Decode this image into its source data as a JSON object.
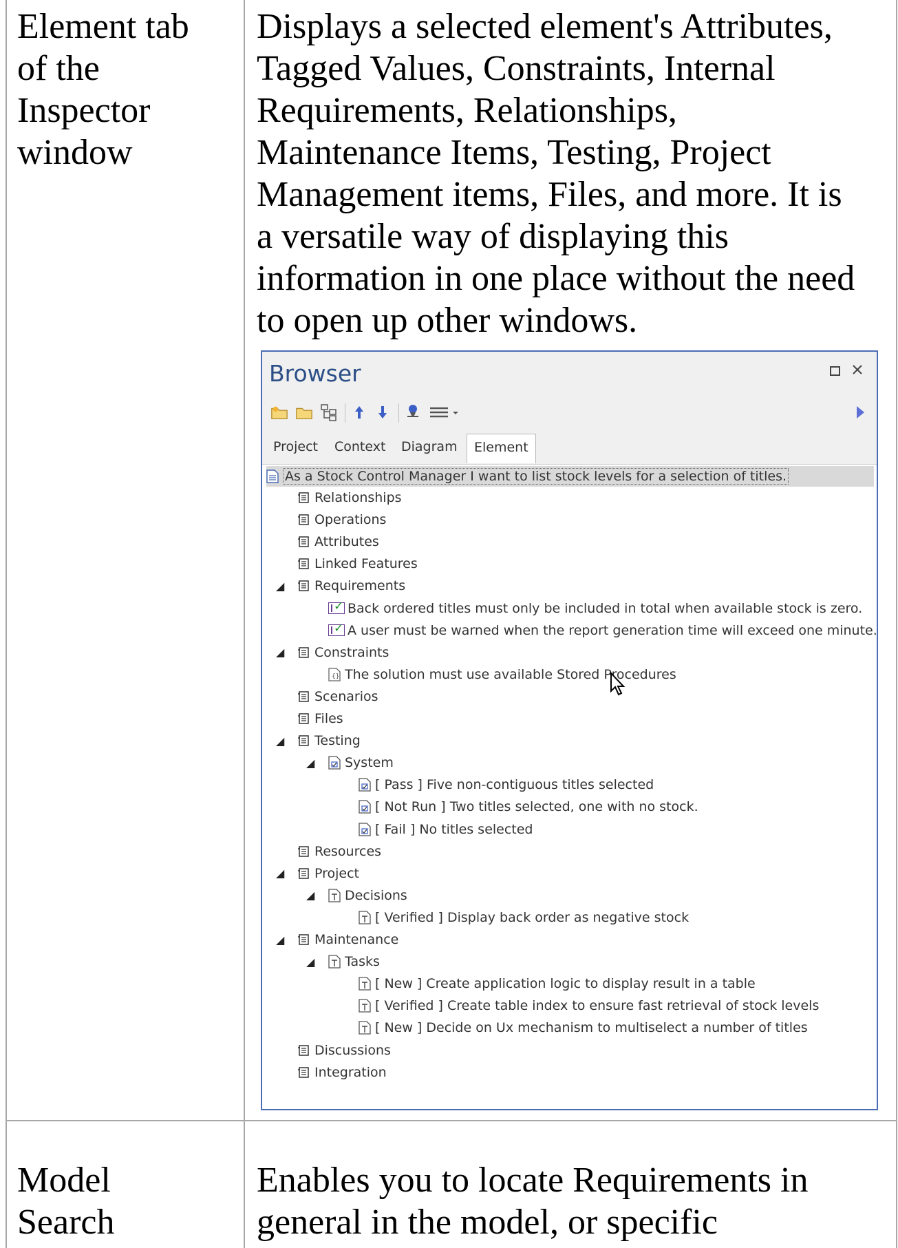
{
  "row1": {
    "term": [
      "Element tab",
      "of the",
      "Inspector",
      "window"
    ],
    "description": [
      "Displays a selected element's Attributes,",
      "Tagged Values, Constraints, Internal",
      "Requirements, Relationships,",
      "Maintenance Items, Testing, Project",
      "Management items, Files, and more. It is",
      "a versatile way of displaying this",
      "information in one place without the need",
      "to open up other windows."
    ]
  },
  "browser": {
    "title": "Browser",
    "maximize_icon": "maximize-icon",
    "close_icon": "close-icon",
    "tabs": [
      "Project",
      "Context",
      "Diagram",
      "Element"
    ],
    "active_tab": "Element",
    "selected_item": "As a Stock Control Manager I want to list stock levels for a selection of titles.",
    "tree": [
      {
        "label": "Relationships",
        "icon": "compartment-icon",
        "level": 1,
        "expanded": false
      },
      {
        "label": "Operations",
        "icon": "compartment-icon",
        "level": 1,
        "expanded": false
      },
      {
        "label": "Attributes",
        "icon": "compartment-icon",
        "level": 1,
        "expanded": false
      },
      {
        "label": "Linked Features",
        "icon": "compartment-icon",
        "level": 1,
        "expanded": false
      },
      {
        "label": "Requirements",
        "icon": "compartment-icon",
        "level": 1,
        "expanded": true
      },
      {
        "label": "Back ordered titles must only be included in total when available stock is zero.",
        "icon": "requirement-check-icon",
        "level": 2
      },
      {
        "label": "A user must be warned when the report generation time will exceed one minute.",
        "icon": "requirement-check-icon",
        "level": 2
      },
      {
        "label": "Constraints",
        "icon": "compartment-icon",
        "level": 1,
        "expanded": true
      },
      {
        "label": "The solution must use available Stored Procedures",
        "icon": "constraint-icon",
        "level": 2
      },
      {
        "label": "Scenarios",
        "icon": "compartment-icon",
        "level": 1,
        "expanded": false
      },
      {
        "label": "Files",
        "icon": "compartment-icon",
        "level": 1,
        "expanded": false
      },
      {
        "label": "Testing",
        "icon": "compartment-icon",
        "level": 1,
        "expanded": true
      },
      {
        "label": "System",
        "icon": "test-icon",
        "level": 2,
        "expanded": true
      },
      {
        "label": "[ Pass ] Five non-contiguous titles selected",
        "icon": "test-icon",
        "level": 3
      },
      {
        "label": "[ Not Run ] Two titles selected, one with no stock.",
        "icon": "test-icon",
        "level": 3
      },
      {
        "label": "[ Fail ] No titles selected",
        "icon": "test-icon",
        "level": 3
      },
      {
        "label": "Resources",
        "icon": "compartment-icon",
        "level": 1,
        "expanded": false
      },
      {
        "label": "Project",
        "icon": "compartment-icon",
        "level": 1,
        "expanded": true
      },
      {
        "label": "Decisions",
        "icon": "document-icon",
        "level": 2,
        "expanded": true
      },
      {
        "label": "[ Verified ] Display back order as negative stock",
        "icon": "document-icon",
        "level": 3
      },
      {
        "label": "Maintenance",
        "icon": "compartment-icon",
        "level": 1,
        "expanded": true
      },
      {
        "label": "Tasks",
        "icon": "document-icon",
        "level": 2,
        "expanded": true
      },
      {
        "label": "[ New ] Create application logic to display result in a table",
        "icon": "document-icon",
        "level": 3
      },
      {
        "label": "[ Verified ] Create table index to ensure fast retrieval of stock levels",
        "icon": "document-icon",
        "level": 3
      },
      {
        "label": "[ New ] Decide on Ux mechanism to multiselect a number of titles",
        "icon": "document-icon",
        "level": 3
      },
      {
        "label": "Discussions",
        "icon": "compartment-icon",
        "level": 1,
        "expanded": false
      },
      {
        "label": "Integration",
        "icon": "compartment-icon",
        "level": 1,
        "expanded": false
      }
    ]
  },
  "row2": {
    "term": [
      "Model",
      "Search"
    ],
    "description": [
      "Enables you to locate Requirements in",
      "general in the model, or specific"
    ]
  }
}
